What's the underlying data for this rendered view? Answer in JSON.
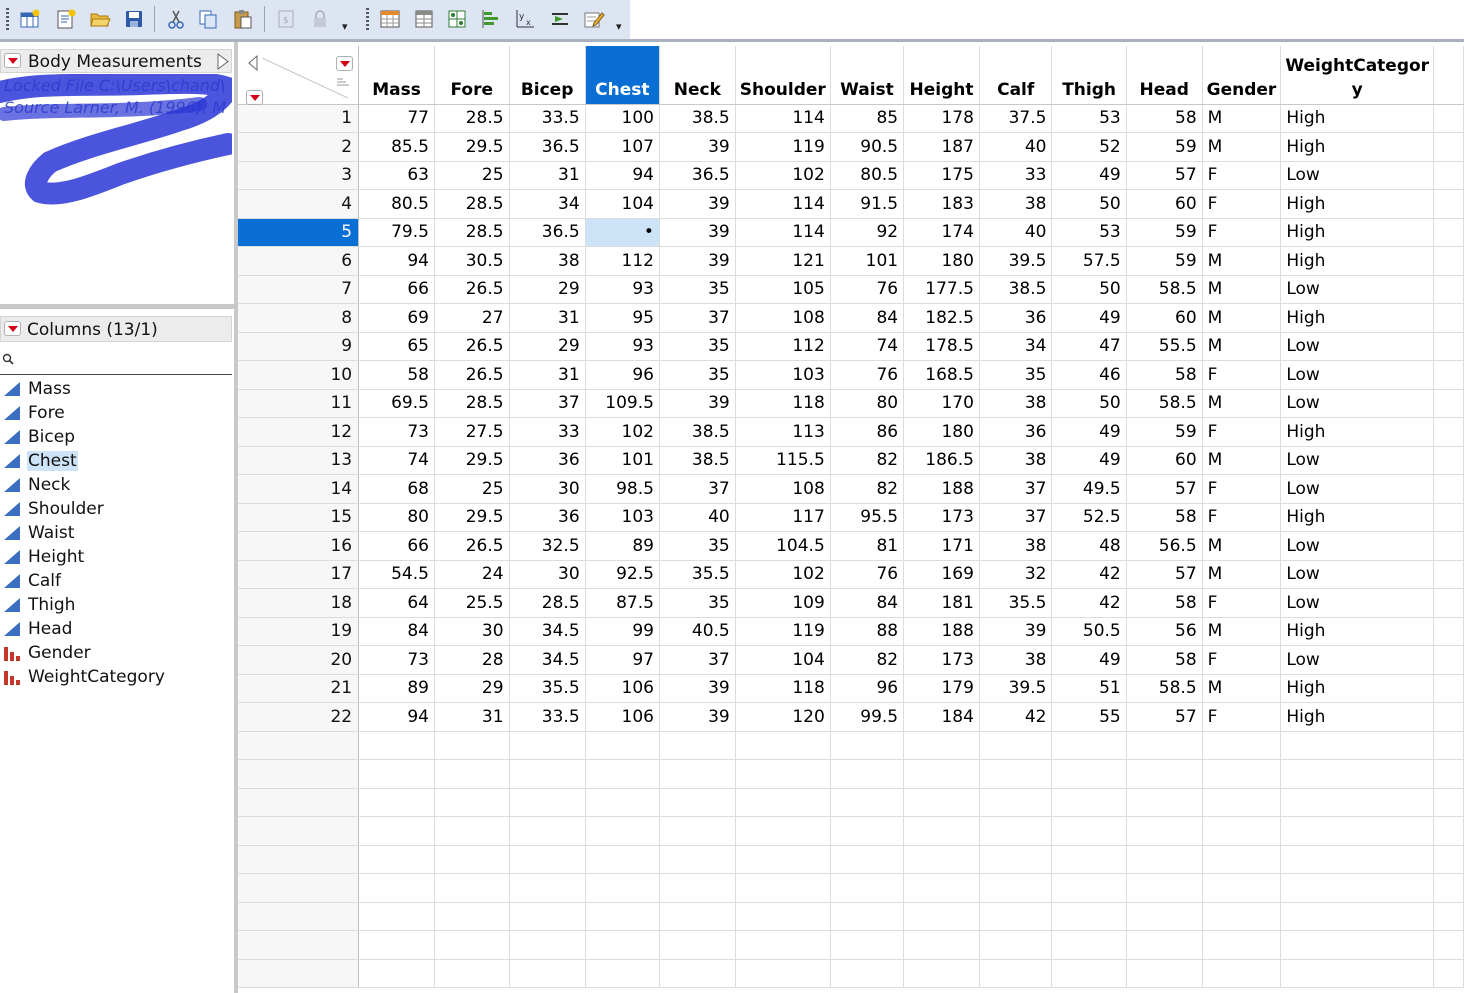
{
  "toolbar": {
    "buttons": [
      {
        "name": "new-data-table",
        "icon": "new-table-icon"
      },
      {
        "name": "new-script",
        "icon": "new-script-icon"
      },
      {
        "name": "open",
        "icon": "folder-open-icon"
      },
      {
        "name": "save",
        "icon": "save-icon"
      },
      {
        "name": "cut",
        "icon": "scissors-icon"
      },
      {
        "name": "copy",
        "icon": "copy-icon"
      },
      {
        "name": "paste",
        "icon": "paste-icon"
      },
      {
        "name": "link",
        "icon": "link-icon"
      },
      {
        "name": "lock",
        "icon": "lock-icon"
      },
      {
        "name": "data-table",
        "icon": "data-table-icon"
      },
      {
        "name": "table-properties",
        "icon": "table-grid-icon"
      },
      {
        "name": "fit-model",
        "icon": "fit-model-icon"
      },
      {
        "name": "distribution",
        "icon": "distribution-icon"
      },
      {
        "name": "fit-y-by-x",
        "icon": "fit-y-by-x-icon"
      },
      {
        "name": "graph-builder",
        "icon": "graph-builder-icon"
      },
      {
        "name": "script-editor",
        "icon": "pencil-table-icon"
      }
    ]
  },
  "left_panel": {
    "table_title": "Body Measurements",
    "meta": [
      "Locked File  C:\\Users\\chand\\",
      "Source  Larner, M. (1996). M"
    ],
    "columns_header": "Columns (13/1)",
    "search_placeholder": "",
    "columns": [
      {
        "name": "Mass",
        "type": "continuous"
      },
      {
        "name": "Fore",
        "type": "continuous"
      },
      {
        "name": "Bicep",
        "type": "continuous"
      },
      {
        "name": "Chest",
        "type": "continuous",
        "selected": true
      },
      {
        "name": "Neck",
        "type": "continuous"
      },
      {
        "name": "Shoulder",
        "type": "continuous"
      },
      {
        "name": "Waist",
        "type": "continuous"
      },
      {
        "name": "Height",
        "type": "continuous"
      },
      {
        "name": "Calf",
        "type": "continuous"
      },
      {
        "name": "Thigh",
        "type": "continuous"
      },
      {
        "name": "Head",
        "type": "continuous"
      },
      {
        "name": "Gender",
        "type": "nominal"
      },
      {
        "name": "WeightCategory",
        "type": "nominal"
      }
    ]
  },
  "grid": {
    "headers": [
      "Mass",
      "Fore",
      "Bicep",
      "Chest",
      "Neck",
      "Shoulder",
      "Waist",
      "Height",
      "Calf",
      "Thigh",
      "Head",
      "Gender",
      "WeightCategor y"
    ],
    "selected_column": "Chest",
    "selected_row": 5,
    "missing_symbol": "•",
    "rows": [
      [
        "1",
        "77",
        "28.5",
        "33.5",
        "100",
        "38.5",
        "114",
        "85",
        "178",
        "37.5",
        "53",
        "58",
        "M",
        "High"
      ],
      [
        "2",
        "85.5",
        "29.5",
        "36.5",
        "107",
        "39",
        "119",
        "90.5",
        "187",
        "40",
        "52",
        "59",
        "M",
        "High"
      ],
      [
        "3",
        "63",
        "25",
        "31",
        "94",
        "36.5",
        "102",
        "80.5",
        "175",
        "33",
        "49",
        "57",
        "F",
        "Low"
      ],
      [
        "4",
        "80.5",
        "28.5",
        "34",
        "104",
        "39",
        "114",
        "91.5",
        "183",
        "38",
        "50",
        "60",
        "F",
        "High"
      ],
      [
        "5",
        "79.5",
        "28.5",
        "36.5",
        "•",
        "39",
        "114",
        "92",
        "174",
        "40",
        "53",
        "59",
        "F",
        "High"
      ],
      [
        "6",
        "94",
        "30.5",
        "38",
        "112",
        "39",
        "121",
        "101",
        "180",
        "39.5",
        "57.5",
        "59",
        "M",
        "High"
      ],
      [
        "7",
        "66",
        "26.5",
        "29",
        "93",
        "35",
        "105",
        "76",
        "177.5",
        "38.5",
        "50",
        "58.5",
        "M",
        "Low"
      ],
      [
        "8",
        "69",
        "27",
        "31",
        "95",
        "37",
        "108",
        "84",
        "182.5",
        "36",
        "49",
        "60",
        "M",
        "High"
      ],
      [
        "9",
        "65",
        "26.5",
        "29",
        "93",
        "35",
        "112",
        "74",
        "178.5",
        "34",
        "47",
        "55.5",
        "M",
        "Low"
      ],
      [
        "10",
        "58",
        "26.5",
        "31",
        "96",
        "35",
        "103",
        "76",
        "168.5",
        "35",
        "46",
        "58",
        "F",
        "Low"
      ],
      [
        "11",
        "69.5",
        "28.5",
        "37",
        "109.5",
        "39",
        "118",
        "80",
        "170",
        "38",
        "50",
        "58.5",
        "M",
        "Low"
      ],
      [
        "12",
        "73",
        "27.5",
        "33",
        "102",
        "38.5",
        "113",
        "86",
        "180",
        "36",
        "49",
        "59",
        "F",
        "High"
      ],
      [
        "13",
        "74",
        "29.5",
        "36",
        "101",
        "38.5",
        "115.5",
        "82",
        "186.5",
        "38",
        "49",
        "60",
        "M",
        "Low"
      ],
      [
        "14",
        "68",
        "25",
        "30",
        "98.5",
        "37",
        "108",
        "82",
        "188",
        "37",
        "49.5",
        "57",
        "F",
        "Low"
      ],
      [
        "15",
        "80",
        "29.5",
        "36",
        "103",
        "40",
        "117",
        "95.5",
        "173",
        "37",
        "52.5",
        "58",
        "F",
        "High"
      ],
      [
        "16",
        "66",
        "26.5",
        "32.5",
        "89",
        "35",
        "104.5",
        "81",
        "171",
        "38",
        "48",
        "56.5",
        "M",
        "Low"
      ],
      [
        "17",
        "54.5",
        "24",
        "30",
        "92.5",
        "35.5",
        "102",
        "76",
        "169",
        "32",
        "42",
        "57",
        "M",
        "Low"
      ],
      [
        "18",
        "64",
        "25.5",
        "28.5",
        "87.5",
        "35",
        "109",
        "84",
        "181",
        "35.5",
        "42",
        "58",
        "F",
        "Low"
      ],
      [
        "19",
        "84",
        "30",
        "34.5",
        "99",
        "40.5",
        "119",
        "88",
        "188",
        "39",
        "50.5",
        "56",
        "M",
        "High"
      ],
      [
        "20",
        "73",
        "28",
        "34.5",
        "97",
        "37",
        "104",
        "82",
        "173",
        "38",
        "49",
        "58",
        "F",
        "Low"
      ],
      [
        "21",
        "89",
        "29",
        "35.5",
        "106",
        "39",
        "118",
        "96",
        "179",
        "39.5",
        "51",
        "58.5",
        "M",
        "High"
      ],
      [
        "22",
        "94",
        "31",
        "33.5",
        "106",
        "39",
        "120",
        "99.5",
        "184",
        "42",
        "55",
        "57",
        "F",
        "High"
      ]
    ]
  },
  "colors": {
    "selection_blue": "#0a6fd4",
    "cell_highlight": "#cde3f7",
    "continuous_icon": "#3a6fc2",
    "nominal_icon": "#c0392b",
    "red_triangle": "#d4001a"
  }
}
